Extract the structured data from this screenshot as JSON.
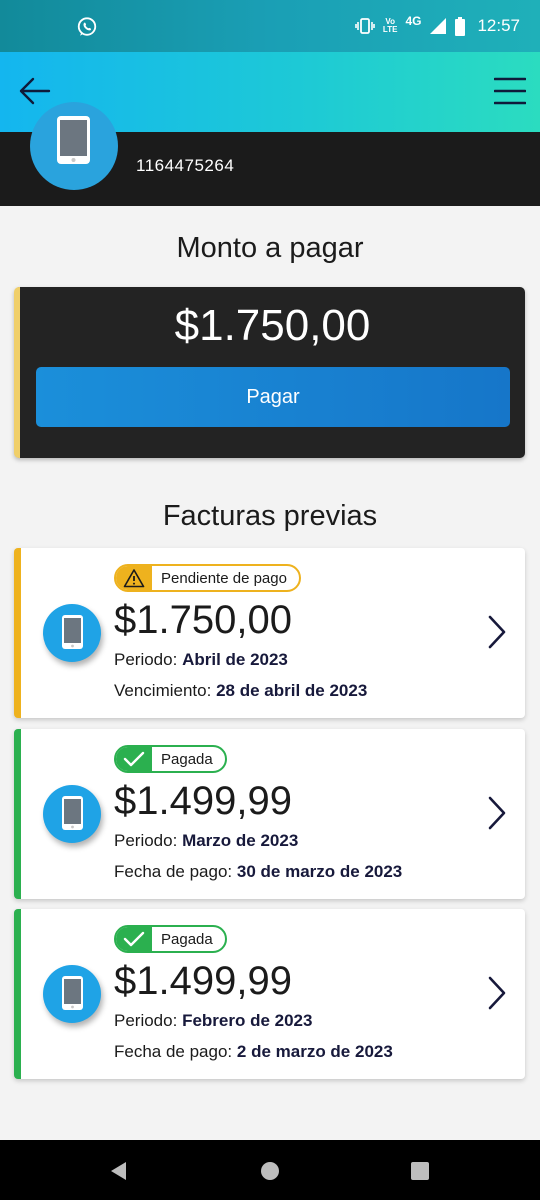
{
  "status_bar": {
    "time": "12:57",
    "network": "4G",
    "volte_line1": "Vo",
    "volte_line2": "LTE",
    "icons": [
      "whatsapp-icon",
      "vibrate-icon",
      "volte-icon",
      "signal-icon",
      "battery-icon"
    ]
  },
  "app_bar": {
    "icons": [
      "back-arrow-icon",
      "hamburger-menu-icon"
    ]
  },
  "account": {
    "line_number": "1164475264",
    "icon": "mobile-phone-icon"
  },
  "payment": {
    "title": "Monto a pagar",
    "amount": "$1.750,00",
    "pay_label": "Pagar"
  },
  "invoices": {
    "title": "Facturas previas",
    "items": [
      {
        "status": "Pendiente de pago",
        "status_icon": "warning-icon",
        "amount": "$1.750,00",
        "period_label": "Periodo:",
        "period_value": "Abril de 2023",
        "date_label": "Vencimiento:",
        "date_value": "28 de abril de 2023"
      },
      {
        "status": "Pagada",
        "status_icon": "check-icon",
        "amount": "$1.499,99",
        "period_label": "Periodo:",
        "period_value": "Marzo de 2023",
        "date_label": "Fecha de pago:",
        "date_value": "30 de marzo de 2023"
      },
      {
        "status": "Pagada",
        "status_icon": "check-icon",
        "amount": "$1.499,99",
        "period_label": "Periodo:",
        "period_value": "Febrero de 2023",
        "date_label": "Fecha de pago:",
        "date_value": "2 de marzo de 2023"
      }
    ]
  },
  "colors": {
    "pending": "#eeb21e",
    "paid": "#2bb04f",
    "primary_button": "#1b8fda",
    "header_dark": "#1b1b1b",
    "accent_yellow": "#f0cf6a"
  },
  "nav_bar": {
    "icons": [
      "back-triangle-icon",
      "home-circle-icon",
      "recents-square-icon"
    ]
  }
}
